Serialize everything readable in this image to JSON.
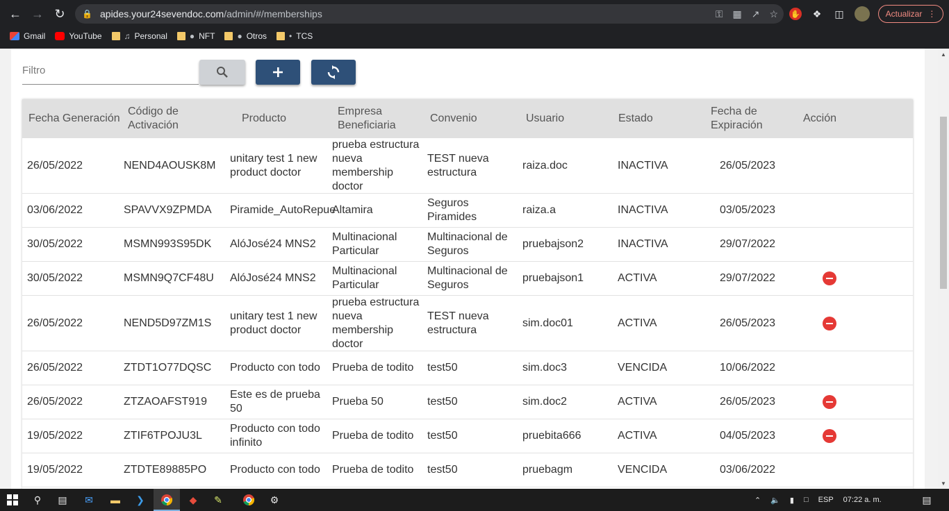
{
  "browser": {
    "url_host": "apides.your24sevendoc.com",
    "url_path": "/admin/#/memberships",
    "update_label": "Actualizar",
    "bookmarks": [
      {
        "label": "Gmail",
        "icon": "gmail-icon"
      },
      {
        "label": "YouTube",
        "icon": "youtube-icon"
      },
      {
        "label": "Personal",
        "icon": "folder-icon"
      },
      {
        "label": "NFT",
        "icon": "folder-icon"
      },
      {
        "label": "Otros",
        "icon": "folder-icon"
      },
      {
        "label": "TCS",
        "icon": "folder-icon"
      }
    ]
  },
  "toolbar": {
    "filter_placeholder": "Filtro",
    "search_icon": "search-icon",
    "add_icon": "plus-icon",
    "refresh_icon": "refresh-icon"
  },
  "table": {
    "headers": {
      "fecha_generacion": "Fecha Generación",
      "codigo_activacion": "Código de Activación",
      "producto": "Producto",
      "empresa": "Empresa Beneficiaria",
      "convenio": "Convenio",
      "usuario": "Usuario",
      "estado": "Estado",
      "fecha_expiracion": "Fecha de Expiración",
      "accion": "Acción"
    },
    "rows": [
      {
        "fecha": "26/05/2022",
        "codigo": "NEND4AOUSK8M",
        "producto": "unitary test 1 new product doctor",
        "empresa": "prueba estructura nueva membership doctor",
        "convenio": "TEST nueva estructura",
        "usuario": "raiza.doc",
        "estado": "INACTIVA",
        "expira": "26/05/2023",
        "accion": ""
      },
      {
        "fecha": "03/06/2022",
        "codigo": "SPAVVX9ZPMDA",
        "producto": "Piramide_AutoRepue",
        "empresa": "Altamira",
        "convenio": "Seguros Piramides",
        "usuario": "raiza.a",
        "estado": "INACTIVA",
        "expira": "03/05/2023",
        "accion": ""
      },
      {
        "fecha": "30/05/2022",
        "codigo": "MSMN993S95DK",
        "producto": "AlóJosé24 MNS2",
        "empresa": "Multinacional Particular",
        "convenio": "Multinacional de Seguros",
        "usuario": "pruebajson2",
        "estado": "INACTIVA",
        "expira": "29/07/2022",
        "accion": ""
      },
      {
        "fecha": "30/05/2022",
        "codigo": "MSMN9Q7CF48U",
        "producto": "AlóJosé24 MNS2",
        "empresa": "Multinacional Particular",
        "convenio": "Multinacional de Seguros",
        "usuario": "pruebajson1",
        "estado": "ACTIVA",
        "expira": "29/07/2022",
        "accion": "remove-circle-icon"
      },
      {
        "fecha": "26/05/2022",
        "codigo": "NEND5D97ZM1S",
        "producto": "unitary test 1 new product doctor",
        "empresa": "prueba estructura nueva membership doctor",
        "convenio": "TEST nueva estructura",
        "usuario": "sim.doc01",
        "estado": "ACTIVA",
        "expira": "26/05/2023",
        "accion": "remove-circle-icon"
      },
      {
        "fecha": "26/05/2022",
        "codigo": "ZTDT1O77DQSC",
        "producto": "Producto con todo",
        "empresa": "Prueba de todito",
        "convenio": "test50",
        "usuario": "sim.doc3",
        "estado": "VENCIDA",
        "expira": "10/06/2022",
        "accion": ""
      },
      {
        "fecha": "26/05/2022",
        "codigo": "ZTZAOAFST919",
        "producto": "Este es de prueba 50",
        "empresa": "Prueba 50",
        "convenio": "test50",
        "usuario": "sim.doc2",
        "estado": "ACTIVA",
        "expira": "26/05/2023",
        "accion": "remove-circle-icon"
      },
      {
        "fecha": "19/05/2022",
        "codigo": "ZTIF6TPOJU3L",
        "producto": "Producto con todo infinito",
        "empresa": "Prueba de todito",
        "convenio": "test50",
        "usuario": "pruebita666",
        "estado": "ACTIVA",
        "expira": "04/05/2023",
        "accion": "remove-circle-icon"
      },
      {
        "fecha": "19/05/2022",
        "codigo": "ZTDTE89885PO",
        "producto": "Producto con todo",
        "empresa": "Prueba de todito",
        "convenio": "test50",
        "usuario": "pruebagm",
        "estado": "VENCIDA",
        "expira": "03/06/2022",
        "accion": ""
      }
    ]
  },
  "taskbar": {
    "language": "ESP",
    "time": "07:22 a. m."
  }
}
